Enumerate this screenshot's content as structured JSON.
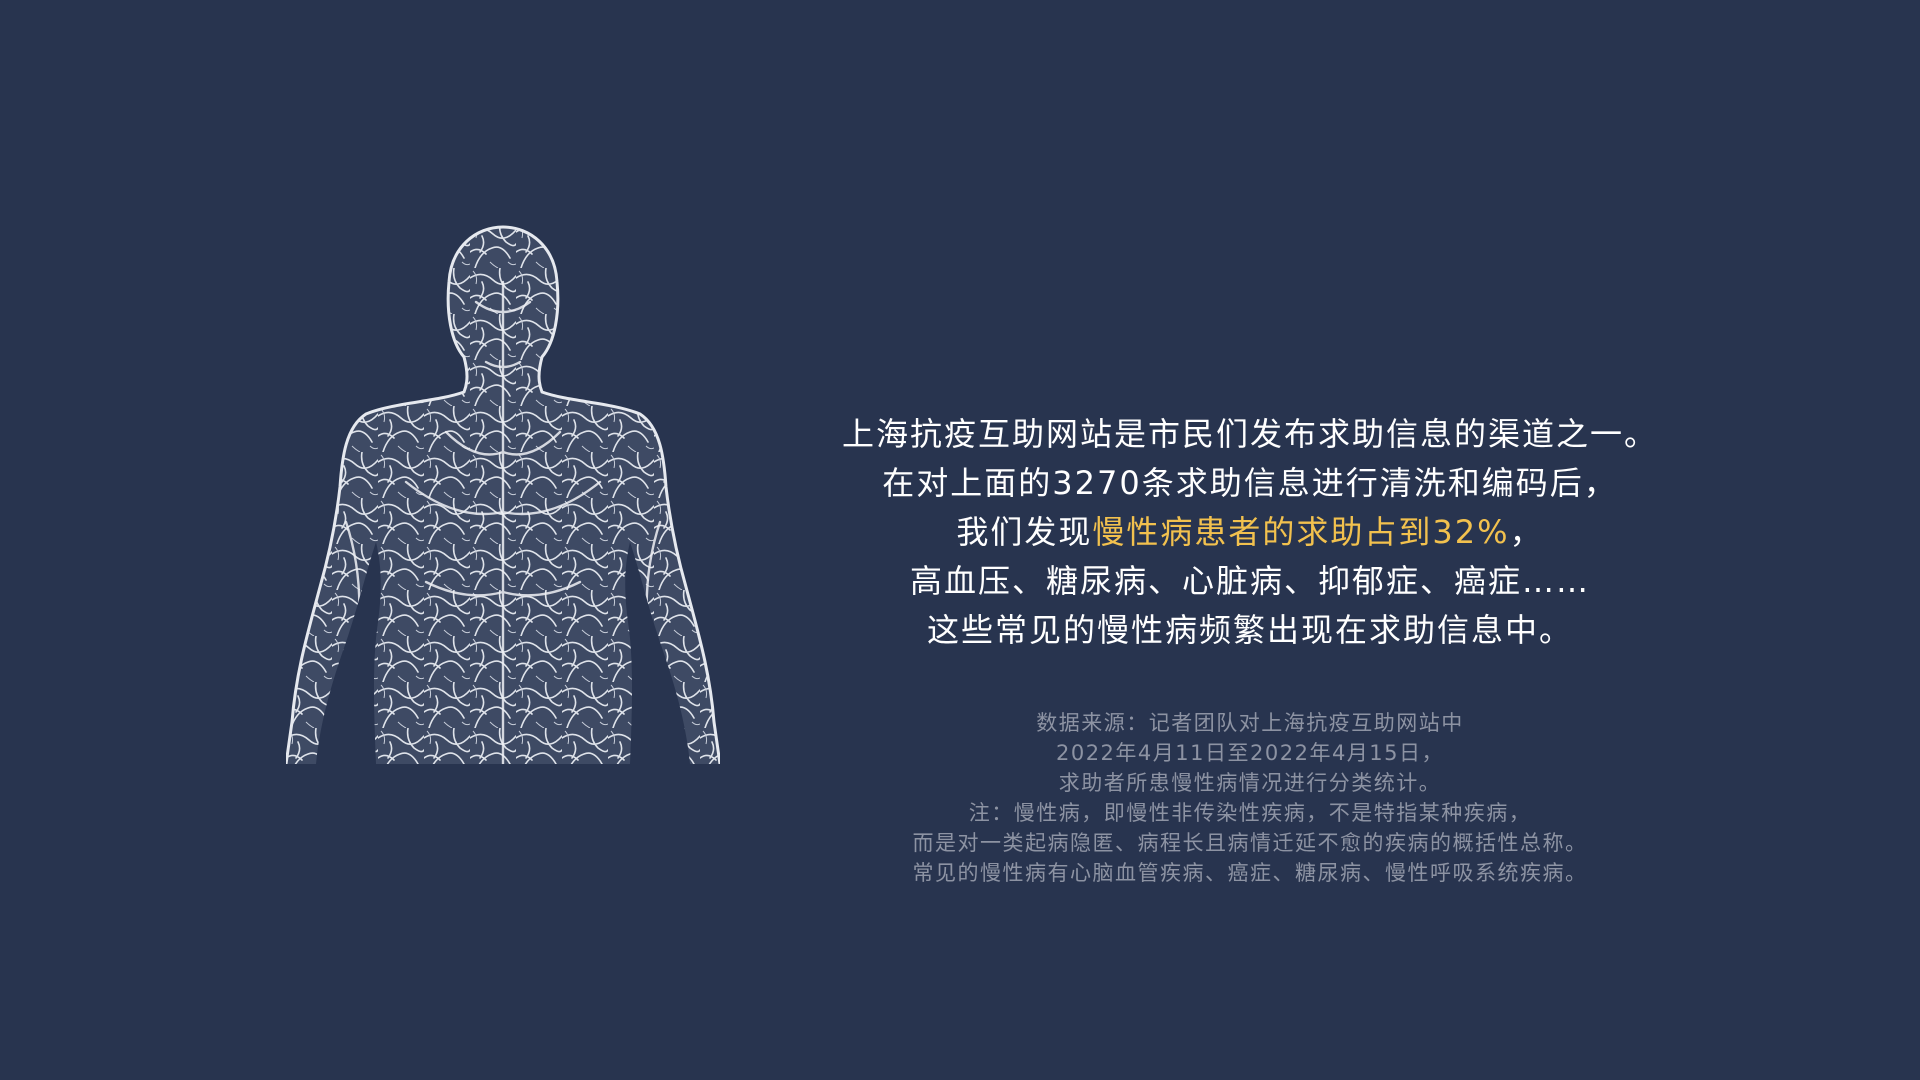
{
  "colors": {
    "background": "#28344f",
    "text": "#ffffff",
    "highlight": "#f2c14e",
    "note": "#8d93a3",
    "figure_line": "#d9dde6"
  },
  "illustration": {
    "icon": "human-circulatory-body-icon"
  },
  "main_text": {
    "line1": "上海抗疫互助网站是市民们发布求助信息的渠道之一。",
    "line2": "在对上面的3270条求助信息进行清洗和编码后，",
    "line3_prefix": "我们发现",
    "line3_highlight": "慢性病患者的求助占到32%",
    "line3_suffix": "，",
    "line4": "高血压、糖尿病、心脏病、抑郁症、癌症……",
    "line5": "这些常见的慢性病频繁出现在求助信息中。"
  },
  "source_note": {
    "line1": "数据来源：记者团队对上海抗疫互助网站中",
    "line2": "2022年4月11日至2022年4月15日，",
    "line3": "求助者所患慢性病情况进行分类统计。",
    "line4": "注：慢性病，即慢性非传染性疾病，不是特指某种疾病，",
    "line5": "而是对一类起病隐匿、病程长且病情迁延不愈的疾病的概括性总称。",
    "line6": "常见的慢性病有心脑血管疾病、癌症、糖尿病、慢性呼吸系统疾病。"
  }
}
